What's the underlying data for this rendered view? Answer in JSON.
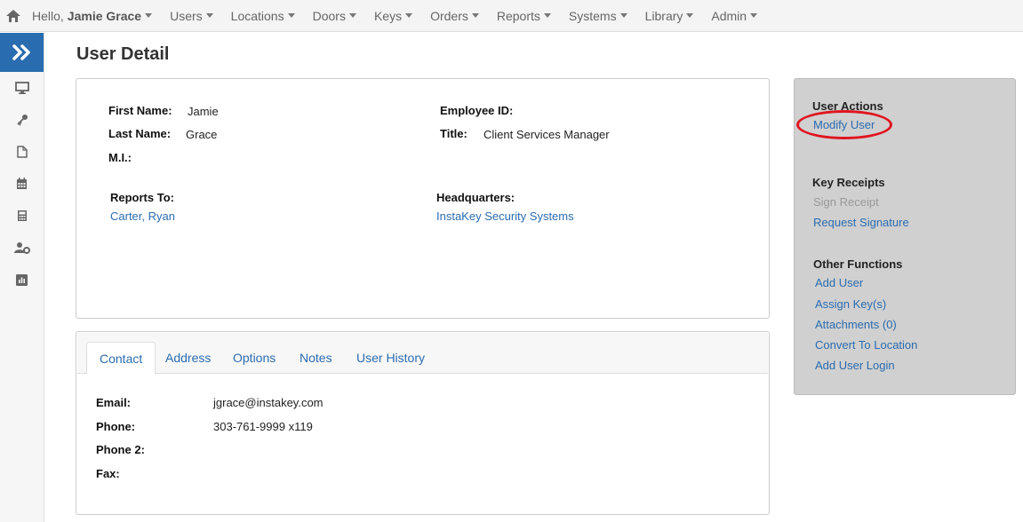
{
  "nav": {
    "greeting": "Hello,",
    "user_name": "Jamie Grace",
    "menus": [
      "Users",
      "Locations",
      "Doors",
      "Keys",
      "Orders",
      "Reports",
      "Systems",
      "Library",
      "Admin"
    ]
  },
  "page": {
    "title": "User Detail"
  },
  "detail": {
    "first_name_label": "First Name:",
    "first_name": "Jamie",
    "last_name_label": "Last Name:",
    "last_name": "Grace",
    "mi_label": "M.I.:",
    "employee_id_label": "Employee ID:",
    "title_label": "Title:",
    "title": "Client Services Manager",
    "reports_to_label": "Reports To:",
    "reports_to": "Carter, Ryan",
    "hq_label": "Headquarters:",
    "hq": "InstaKey Security Systems"
  },
  "tabs": [
    "Contact",
    "Address",
    "Options",
    "Notes",
    "User History"
  ],
  "contact": {
    "email_label": "Email:",
    "email": "jgrace@instakey.com",
    "phone_label": "Phone:",
    "phone": "303-761-9999 x119",
    "phone2_label": "Phone 2:",
    "fax_label": "Fax:"
  },
  "actions": {
    "user_actions_header": "User Actions",
    "modify_user": "Modify User",
    "key_receipts_header": "Key Receipts",
    "sign_receipt": "Sign Receipt",
    "request_signature": "Request Signature",
    "other_functions_header": "Other Functions",
    "add_user": "Add User",
    "assign_keys": "Assign Key(s)",
    "attachments": "Attachments (0)",
    "convert_to_location": "Convert To Location",
    "add_user_login": "Add User Login"
  },
  "colors": {
    "accent": "#2a6cb0",
    "highlight_circle": "#e0151f",
    "panel_bg": "#d0d0d0"
  }
}
